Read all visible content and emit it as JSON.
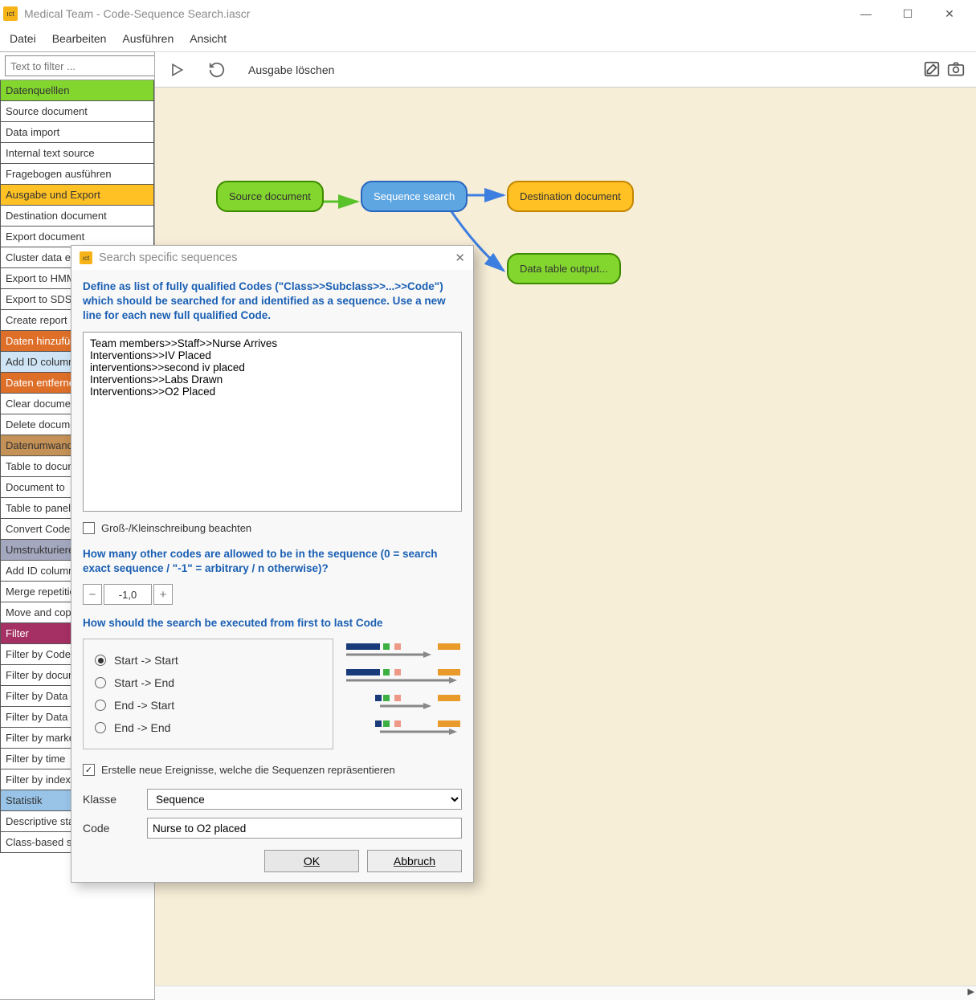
{
  "window": {
    "title": "Medical Team - Code-Sequence Search.iascr"
  },
  "menu": {
    "items": [
      "Datei",
      "Bearbeiten",
      "Ausführen",
      "Ansicht"
    ]
  },
  "toolbar": {
    "clear_output_label": "Ausgabe löschen"
  },
  "sidebar": {
    "filter_placeholder": "Text to filter ...",
    "items": [
      {
        "text": "Datenquelllen",
        "cls": "li-datenq"
      },
      {
        "text": "Source document",
        "cls": ""
      },
      {
        "text": "Data import",
        "cls": ""
      },
      {
        "text": "Internal text source",
        "cls": ""
      },
      {
        "text": "Fragebogen ausführen",
        "cls": ""
      },
      {
        "text": "Ausgabe und Export",
        "cls": "li-ausgabe"
      },
      {
        "text": "Destination document",
        "cls": ""
      },
      {
        "text": "Export document",
        "cls": ""
      },
      {
        "text": "Cluster data export",
        "cls": ""
      },
      {
        "text": "Export to HMM",
        "cls": ""
      },
      {
        "text": "Export to SDS",
        "cls": ""
      },
      {
        "text": "Create report",
        "cls": ""
      },
      {
        "text": "Daten hinzufügen",
        "cls": "li-hinzu"
      },
      {
        "text": "Add ID column",
        "cls": "li-addid-sel"
      },
      {
        "text": "Daten entfernen",
        "cls": "li-entfer"
      },
      {
        "text": "Clear document",
        "cls": ""
      },
      {
        "text": "Delete document",
        "cls": ""
      },
      {
        "text": "Datenumwandlung",
        "cls": "li-datenum"
      },
      {
        "text": "Table to document",
        "cls": ""
      },
      {
        "text": "Document to",
        "cls": ""
      },
      {
        "text": "Table to panel",
        "cls": ""
      },
      {
        "text": "Convert Codes",
        "cls": ""
      },
      {
        "text": "Umstrukturieren",
        "cls": "li-umstr"
      },
      {
        "text": "Add ID column",
        "cls": ""
      },
      {
        "text": "Merge repetitions",
        "cls": ""
      },
      {
        "text": "Move and copy",
        "cls": ""
      },
      {
        "text": "Filter",
        "cls": "li-filter"
      },
      {
        "text": "Filter by Codes",
        "cls": ""
      },
      {
        "text": "Filter by document",
        "cls": ""
      },
      {
        "text": "Filter by Data",
        "cls": ""
      },
      {
        "text": "Filter by Data",
        "cls": ""
      },
      {
        "text": "Filter by marker",
        "cls": ""
      },
      {
        "text": "Filter by time",
        "cls": ""
      },
      {
        "text": "Filter by index",
        "cls": ""
      },
      {
        "text": "Statistik",
        "cls": "li-stat"
      },
      {
        "text": "Descriptive statistics",
        "cls": ""
      },
      {
        "text": "Class-based statistics",
        "cls": ""
      }
    ]
  },
  "canvas": {
    "nodes": {
      "src": "Source document",
      "seq": "Sequence search",
      "dest": "Destination document",
      "table": "Data table output..."
    }
  },
  "dialog": {
    "title": "Search specific sequences",
    "description": "Define as list of fully qualified Codes (\"Class>>Subclass>>...>>Code\") which should be searched for and identified as a sequence. Use a new line for each new full qualified Code.",
    "codes_text": "Team members>>Staff>>Nurse Arrives\nInterventions>>IV Placed\ninterventions>>second iv placed\nInterventions>>Labs Drawn\nInterventions>>O2 Placed",
    "case_label": "Groß-/Kleinschreibung beachten",
    "howmany_label": "How many other codes are allowed to be in the sequence (0 = search exact sequence / \"-1\" = arbitrary / n otherwise)?",
    "spinner_value": "-1,0",
    "howexec_label": "How should the search be executed from first to last Code",
    "radio_options": [
      "Start -> Start",
      "Start -> End",
      "End -> Start",
      "End -> End"
    ],
    "radio_selected": 0,
    "create_events_label": "Erstelle neue Ereignisse, welche die Sequenzen repräsentieren",
    "klasse_label": "Klasse",
    "klasse_value": "Sequence",
    "code_label": "Code",
    "code_value": "Nurse to O2 placed",
    "ok": "OK",
    "cancel": "Abbruch"
  }
}
